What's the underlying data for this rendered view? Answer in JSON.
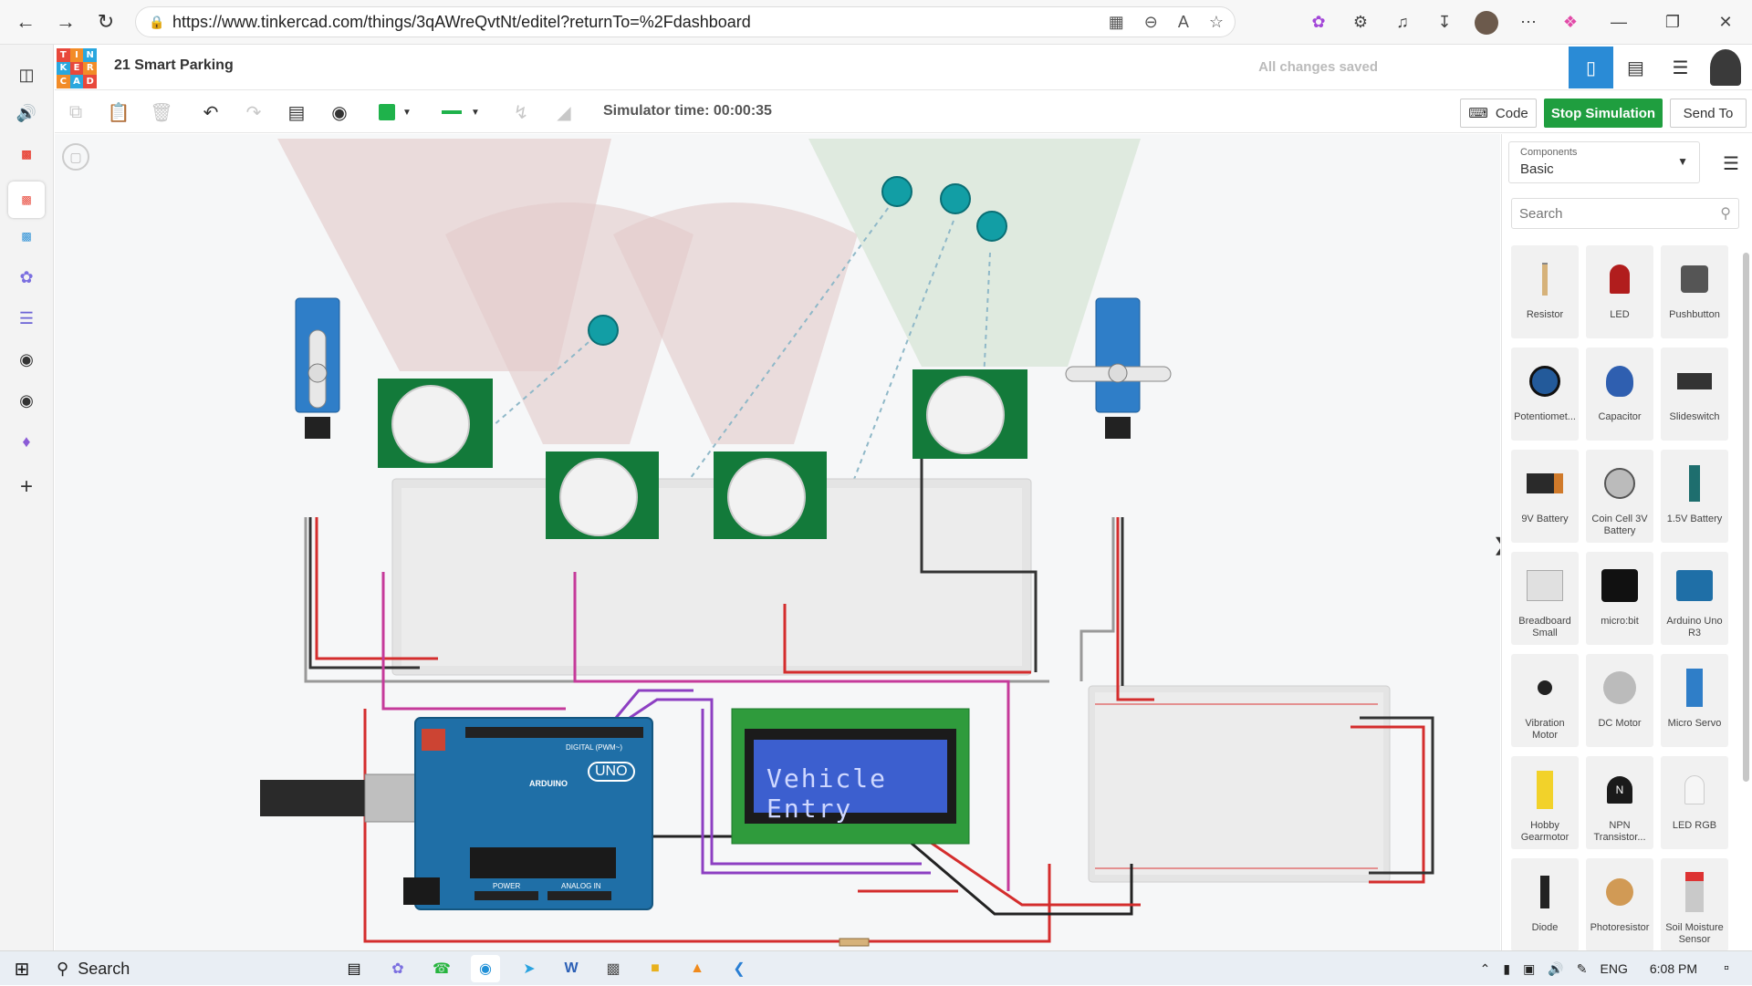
{
  "browser": {
    "url": "https://www.tinkercad.com/things/3qAWreQvtNt/editel?returnTo=%2Fdashboard"
  },
  "header": {
    "logo_letters": [
      "T",
      "I",
      "N",
      "K",
      "E",
      "R",
      "C",
      "A",
      "D"
    ],
    "project_title": "21 Smart Parking",
    "save_status": "All changes saved"
  },
  "toolbar": {
    "sim_time": "Simulator time: 00:00:35",
    "code_label": "Code",
    "stop_label": "Stop Simulation",
    "send_label": "Send To",
    "fill_color": "#1fb24b"
  },
  "canvas": {
    "lcd_text": "Vehicle Entry",
    "arduino_label": "UNO",
    "arduino_brand": "ARDUINO",
    "digital_label": "DIGITAL (PWM~)",
    "power_label": "POWER",
    "analog_label": "ANALOG IN"
  },
  "panel": {
    "components_label": "Components",
    "components_value": "Basic",
    "search_placeholder": "Search",
    "items": [
      {
        "name": "Resistor"
      },
      {
        "name": "LED"
      },
      {
        "name": "Pushbutton"
      },
      {
        "name": "Potentiomet..."
      },
      {
        "name": "Capacitor"
      },
      {
        "name": "Slideswitch"
      },
      {
        "name": "9V Battery"
      },
      {
        "name": "Coin Cell 3V Battery"
      },
      {
        "name": "1.5V Battery"
      },
      {
        "name": "Breadboard Small"
      },
      {
        "name": "micro:bit"
      },
      {
        "name": "Arduino Uno R3"
      },
      {
        "name": "Vibration Motor"
      },
      {
        "name": "DC Motor"
      },
      {
        "name": "Micro Servo"
      },
      {
        "name": "Hobby Gearmotor"
      },
      {
        "name": "NPN Transistor..."
      },
      {
        "name": "LED RGB"
      },
      {
        "name": "Diode"
      },
      {
        "name": "Photoresistor"
      },
      {
        "name": "Soil Moisture Sensor"
      }
    ]
  },
  "taskbar": {
    "search_label": "Search",
    "language": "ENG",
    "time": "6:08 PM"
  }
}
